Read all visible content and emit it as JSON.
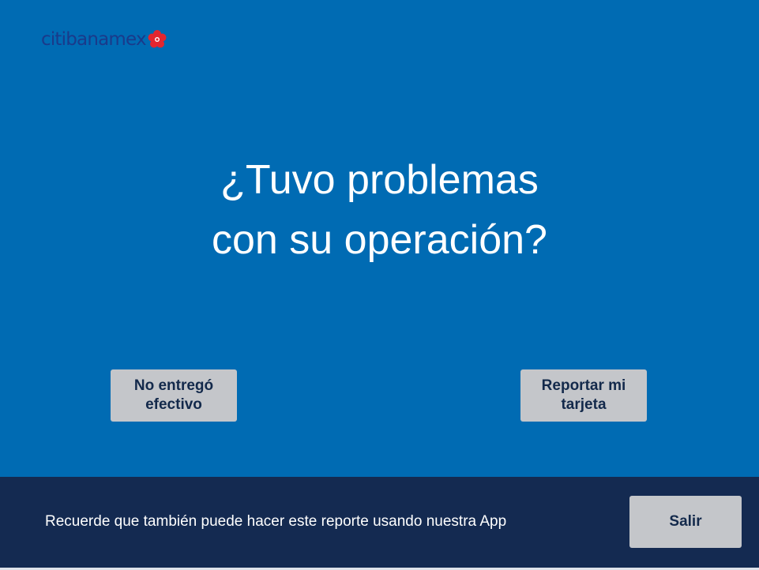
{
  "brand": {
    "logo_text": "citibanamex",
    "logo_color": "#1a3a8a",
    "flower_color": "#e3262f"
  },
  "main": {
    "title_line1": "¿Tuvo problemas",
    "title_line2": "con su operación?"
  },
  "options": {
    "no_cash_label": "No entregó efectivo",
    "report_card_label": "Reportar mi tarjeta"
  },
  "footer": {
    "reminder_text": "Recuerde que también puede hacer este reporte usando nuestra App",
    "exit_label": "Salir"
  },
  "colors": {
    "background": "#006bb3",
    "footer_background": "#142a51",
    "button_background": "#c4c6ca",
    "button_text": "#13294b"
  }
}
